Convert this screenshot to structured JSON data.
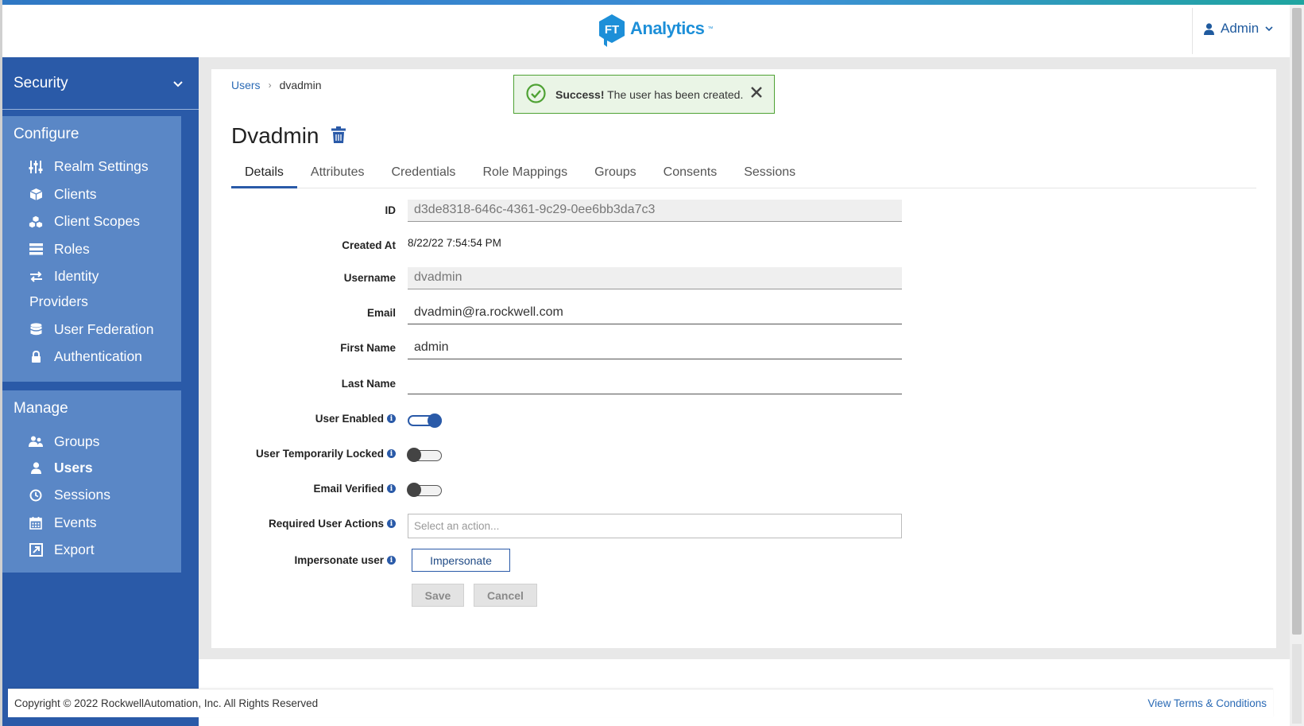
{
  "header": {
    "logo_mark": "FT",
    "logo_text": "Analytics",
    "logo_tm": "™",
    "user_label": "Admin"
  },
  "sidebar": {
    "realm": "Security",
    "configure": {
      "heading": "Configure",
      "items": [
        {
          "label": "Realm Settings",
          "icon": "sliders-icon"
        },
        {
          "label": "Clients",
          "icon": "cube-icon"
        },
        {
          "label": "Client Scopes",
          "icon": "cubes-icon"
        },
        {
          "label": "Roles",
          "icon": "list-icon"
        },
        {
          "label": "Identity",
          "icon": "exchange-icon"
        },
        {
          "label": "Providers",
          "icon": ""
        },
        {
          "label": "User Federation",
          "icon": "database-icon"
        },
        {
          "label": "Authentication",
          "icon": "lock-icon"
        }
      ]
    },
    "manage": {
      "heading": "Manage",
      "items": [
        {
          "label": "Groups",
          "icon": "users-icon"
        },
        {
          "label": "Users",
          "icon": "user-icon",
          "active": true
        },
        {
          "label": "Sessions",
          "icon": "clock-icon"
        },
        {
          "label": "Events",
          "icon": "calendar-icon"
        },
        {
          "label": "Export",
          "icon": "export-icon"
        }
      ]
    }
  },
  "breadcrumb": {
    "parent": "Users",
    "separator": "›",
    "current": "dvadmin"
  },
  "alert": {
    "strong": "Success!",
    "message": " The user has been created.",
    "color": "#4fa234"
  },
  "page": {
    "title": "Dvadmin"
  },
  "tabs": [
    "Details",
    "Attributes",
    "Credentials",
    "Role Mappings",
    "Groups",
    "Consents",
    "Sessions"
  ],
  "form": {
    "id_label": "ID",
    "id_value": "d3de8318-646c-4361-9c29-0ee6bb3da7c3",
    "created_label": "Created At",
    "created_value": "8/22/22 7:54:54 PM",
    "username_label": "Username",
    "username_value": "dvadmin",
    "email_label": "Email",
    "email_value": "dvadmin@ra.rockwell.com",
    "first_name_label": "First Name",
    "first_name_value": "admin",
    "last_name_label": "Last Name",
    "last_name_value": "",
    "user_enabled_label": "User Enabled",
    "user_enabled": true,
    "temp_locked_label": "User Temporarily Locked",
    "temp_locked": false,
    "email_verified_label": "Email Verified",
    "email_verified": false,
    "required_actions_label": "Required User Actions",
    "required_actions_placeholder": "Select an action...",
    "impersonate_label": "Impersonate user",
    "impersonate_button": "Impersonate",
    "save_button": "Save",
    "cancel_button": "Cancel"
  },
  "footer": {
    "copyright": "Copyright © 2022 RockwellAutomation, Inc. All Rights Reserved",
    "terms": "View Terms & Conditions"
  },
  "colors": {
    "sidebar": "#2a5aa8",
    "sidebar_section": "#5a87c6",
    "accent": "#2a5aa8",
    "brand": "#1d8fd8"
  }
}
